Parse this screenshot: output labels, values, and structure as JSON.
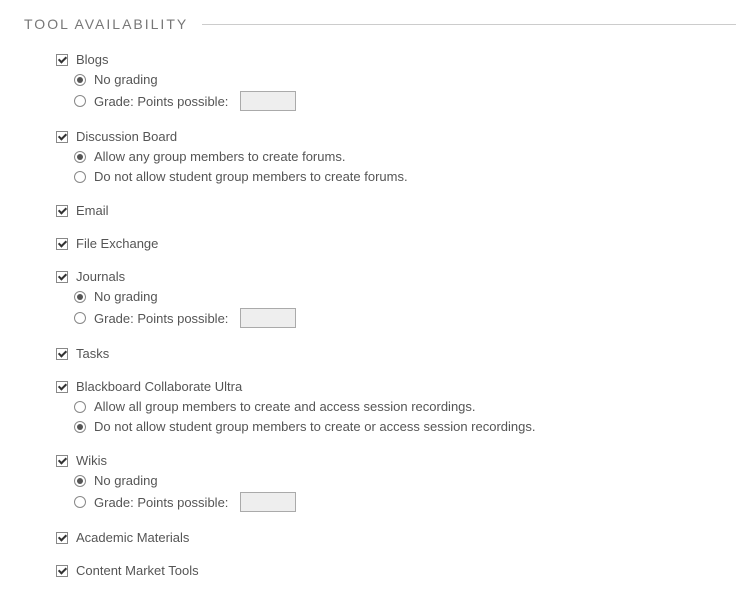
{
  "section": {
    "title": "TOOL AVAILABILITY"
  },
  "tools": {
    "blogs": {
      "label": "Blogs",
      "opt_nograde": "No grading",
      "opt_grade": "Grade: Points possible:",
      "points": ""
    },
    "discussion": {
      "label": "Discussion Board",
      "opt_allow": "Allow any group members to create forums.",
      "opt_deny": "Do not allow student group members to create forums."
    },
    "email": {
      "label": "Email"
    },
    "file_exchange": {
      "label": "File Exchange"
    },
    "journals": {
      "label": "Journals",
      "opt_nograde": "No grading",
      "opt_grade": "Grade: Points possible:",
      "points": ""
    },
    "tasks": {
      "label": "Tasks"
    },
    "collab": {
      "label": "Blackboard Collaborate Ultra",
      "opt_allow": "Allow all group members to create and access session recordings.",
      "opt_deny": "Do not allow student group members to create or access session recordings."
    },
    "wikis": {
      "label": "Wikis",
      "opt_nograde": "No grading",
      "opt_grade": "Grade: Points possible:",
      "points": ""
    },
    "academic": {
      "label": "Academic Materials"
    },
    "market": {
      "label": "Content Market Tools"
    }
  }
}
